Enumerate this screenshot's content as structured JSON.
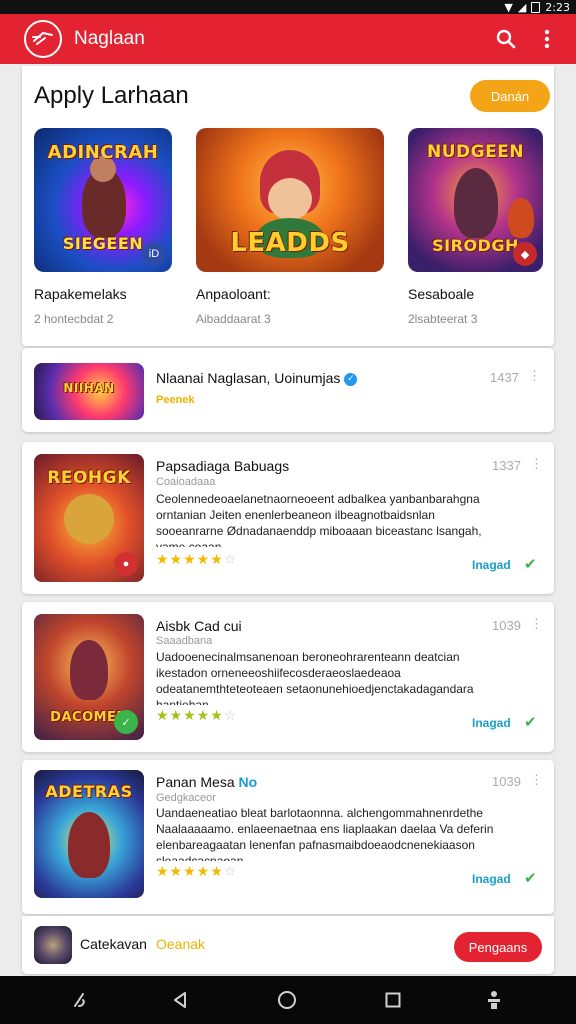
{
  "status": {
    "time": "2:23"
  },
  "appbar": {
    "title": "Naglaan",
    "search_icon": "search-icon",
    "menu_icon": "more-vert-icon"
  },
  "featured": {
    "heading": "Apply Larhaan",
    "button": "Danán",
    "items": [
      {
        "art_title": "ADINCRAH",
        "art_sub": "SIEGEEN",
        "name": "Rapakemelaks",
        "sub": "2 hontecbdat 2"
      },
      {
        "art_title": "LEADDS",
        "art_sub": "",
        "name": "Anpaoloant:",
        "sub": "Aibaddaarat 3"
      },
      {
        "art_title": "NUDGEEN",
        "art_sub": "SIRODGH",
        "name": "Sesaboale",
        "sub": "2lsabteerat 3"
      }
    ]
  },
  "list": [
    {
      "title": "Nlaanai Naglasan, Uoinumjas",
      "verified": true,
      "tag": "Peenek",
      "count": "1437"
    },
    {
      "title": "Papsadiaga Babuags",
      "meta": "Coaioadaaa",
      "count": "1337",
      "desc": "Ceolennedeoaelanetnaorneoeent adbalkea yanbanbarahgna orntanian Jeiten enenlerbeaneon ilbeagnotbaidsnlan sooeanrarne Ødnadanaenddp miboaaan biceastanc lsangah, vame coaan.",
      "rating": 5,
      "action": "Inagad",
      "art_title": "REOHGK"
    },
    {
      "title": "Aisbk Cad cui",
      "meta": "Saaadbana",
      "count": "1039",
      "desc": "Uadooenecinalmsanenoan beroneohrarenteann deatcian ikestadon orneneeoshiifecosderaeoslaedeaoa odeatanemthteteoteaen setaonunehioedjenctakadagandara hantiehan.",
      "rating": 5,
      "action": "Inagad",
      "art_title": "DACOMEN"
    },
    {
      "title": "Panan Mesa",
      "title_tag": "No",
      "meta": "Gedgkaceor",
      "count": "1039",
      "desc": "Uandaeneatiao bleat barlotaonnna. alchengommahnenrdethe Naalaaaaamo. enlaeenaetnaa ens liaplaakan daelaa Va deferin elenbareagaatan lenenfan pafnasmaibdoeaodcnenekiaason sleaadcacnaoan.",
      "rating": 5,
      "action": "Inagad",
      "art_title": "ADETRAS"
    }
  ],
  "bottom": {
    "label": "Catekavan",
    "tag": "Oeanak",
    "button": "Pengaans"
  },
  "colors": {
    "brand": "#e32331",
    "accent": "#f4a417",
    "install": "#1aa0c8",
    "star": "#f5b800",
    "check": "#3bb54a"
  }
}
